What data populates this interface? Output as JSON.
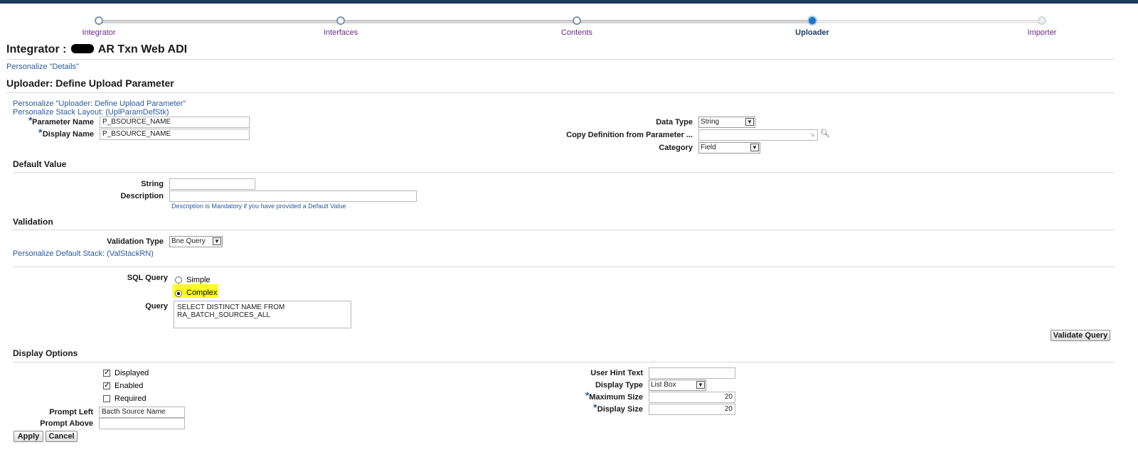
{
  "train": {
    "steps": [
      {
        "label": "Integrator",
        "state": "done"
      },
      {
        "label": "Interfaces",
        "state": "done"
      },
      {
        "label": "Contents",
        "state": "done"
      },
      {
        "label": "Uploader",
        "state": "active"
      },
      {
        "label": "Importer",
        "state": "future"
      }
    ]
  },
  "page": {
    "title_prefix": "Integrator :",
    "title_suffix": "AR Txn Web ADI",
    "personalize_details": "Personalize \"Details\"",
    "section_title": "Uploader: Define Upload Parameter",
    "personalize_uploader": "Personalize \"Uploader: Define Upload Parameter\"",
    "personalize_stack": "Personalize Stack Layout: (UplParamDefStk)"
  },
  "params": {
    "parameter_name_label": "Parameter Name",
    "parameter_name_value": "P_BSOURCE_NAME",
    "display_name_label": "Display Name",
    "display_name_value": "P_BSOURCE_NAME",
    "data_type_label": "Data Type",
    "data_type_value": "String",
    "copy_def_label": "Copy Definition from Parameter ...",
    "copy_def_value": "",
    "category_label": "Category",
    "category_value": "Field"
  },
  "default_value": {
    "title": "Default Value",
    "string_label": "String",
    "string_value": "",
    "description_label": "Description",
    "description_value": "",
    "hint": "Description is Mandatory if you have provided a Default Value"
  },
  "validation": {
    "title": "Validation",
    "type_label": "Validation Type",
    "type_value": "Bne Query",
    "personalize_default_stack": "Personalize Default Stack: (ValStackRN)",
    "sql_query_label": "SQL Query",
    "simple_label": "Simple",
    "complex_label": "Complex",
    "selected": "complex",
    "query_label": "Query",
    "query_value": "SELECT DISTINCT NAME FROM\nRA_BATCH_SOURCES_ALL",
    "validate_button": "Validate Query"
  },
  "display_options": {
    "title": "Display Options",
    "displayed_label": "Displayed",
    "displayed": true,
    "enabled_label": "Enabled",
    "enabled": true,
    "required_label": "Required",
    "required": false,
    "prompt_left_label": "Prompt Left",
    "prompt_left_value": "Bacth Source Name",
    "prompt_above_label": "Prompt Above",
    "prompt_above_value": "",
    "user_hint_label": "User Hint Text",
    "user_hint_value": "",
    "display_type_label": "Display Type",
    "display_type_value": "List Box",
    "max_size_label": "Maximum Size",
    "max_size_value": "20",
    "display_size_label": "Display Size",
    "display_size_value": "20"
  },
  "actions": {
    "apply": "Apply",
    "cancel": "Cancel"
  },
  "colors": {
    "link": "#2a5b9e",
    "highlight": "#ffff1a",
    "active_step": "#1c74c4",
    "header_bar": "#1d3a5f"
  }
}
